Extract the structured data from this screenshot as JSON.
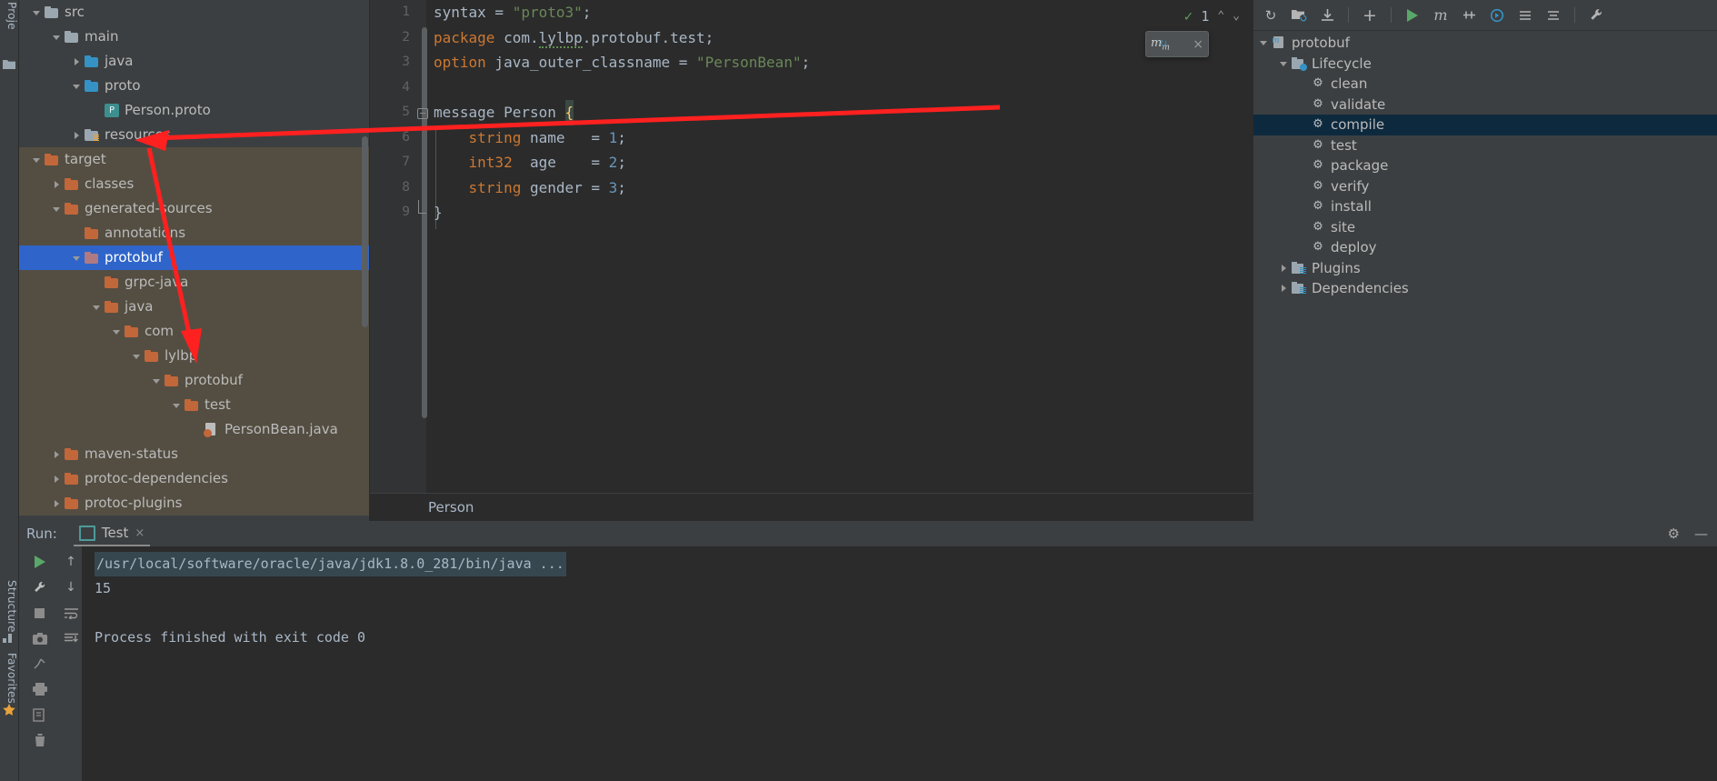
{
  "left_strip": {
    "project_tab": "Proje",
    "structure_tab": "Structure",
    "favorites_tab": "Favorites"
  },
  "project_tree": {
    "items": [
      {
        "label": "src",
        "depth": 1,
        "arrow": "down",
        "icon": "folder-grey",
        "scope": "src"
      },
      {
        "label": "main",
        "depth": 2,
        "arrow": "down",
        "icon": "folder-grey",
        "scope": "src"
      },
      {
        "label": "java",
        "depth": 3,
        "arrow": "right",
        "icon": "folder-blue",
        "scope": "src"
      },
      {
        "label": "proto",
        "depth": 3,
        "arrow": "down",
        "icon": "folder-blue",
        "scope": "src"
      },
      {
        "label": "Person.proto",
        "depth": 4,
        "arrow": "none",
        "icon": "proto-file",
        "scope": "src"
      },
      {
        "label": "resources",
        "depth": 3,
        "arrow": "right",
        "icon": "folder-resources",
        "scope": "src"
      },
      {
        "label": "target",
        "depth": 1,
        "arrow": "down",
        "icon": "folder-orange",
        "scope": "target"
      },
      {
        "label": "classes",
        "depth": 2,
        "arrow": "right",
        "icon": "folder-orange",
        "scope": "target"
      },
      {
        "label": "generated-sources",
        "depth": 2,
        "arrow": "down",
        "icon": "folder-orange",
        "scope": "target"
      },
      {
        "label": "annotations",
        "depth": 3,
        "arrow": "none",
        "icon": "folder-orange",
        "scope": "target"
      },
      {
        "label": "protobuf",
        "depth": 3,
        "arrow": "down",
        "icon": "folder-pink",
        "scope": "target",
        "selected": true
      },
      {
        "label": "grpc-java",
        "depth": 4,
        "arrow": "none",
        "icon": "folder-orange",
        "scope": "target"
      },
      {
        "label": "java",
        "depth": 4,
        "arrow": "down",
        "icon": "folder-orange",
        "scope": "target"
      },
      {
        "label": "com",
        "depth": 5,
        "arrow": "down",
        "icon": "folder-orange",
        "scope": "target"
      },
      {
        "label": "lylbp",
        "depth": 6,
        "arrow": "down",
        "icon": "folder-orange",
        "scope": "target"
      },
      {
        "label": "protobuf",
        "depth": 7,
        "arrow": "down",
        "icon": "folder-orange",
        "scope": "target"
      },
      {
        "label": "test",
        "depth": 8,
        "arrow": "down",
        "icon": "folder-orange",
        "scope": "target"
      },
      {
        "label": "PersonBean.java",
        "depth": 9,
        "arrow": "none",
        "icon": "java-file",
        "scope": "target"
      },
      {
        "label": "maven-status",
        "depth": 2,
        "arrow": "right",
        "icon": "folder-orange",
        "scope": "target"
      },
      {
        "label": "protoc-dependencies",
        "depth": 2,
        "arrow": "right",
        "icon": "folder-orange",
        "scope": "target"
      },
      {
        "label": "protoc-plugins",
        "depth": 2,
        "arrow": "right",
        "icon": "folder-orange",
        "scope": "target"
      }
    ]
  },
  "editor": {
    "breadcrumb": "Person",
    "inspection": {
      "count": "1",
      "up": "⌃",
      "down": "⌄"
    },
    "maven_popup": {
      "glyph": "m",
      "close": "×"
    },
    "lines": [
      {
        "n": "1",
        "tokens": [
          {
            "t": "syntax",
            "c": "pl"
          },
          {
            "t": " = ",
            "c": "pl"
          },
          {
            "t": "\"proto3\"",
            "c": "str"
          },
          {
            "t": ";",
            "c": "pl"
          }
        ]
      },
      {
        "n": "2",
        "tokens": [
          {
            "t": "package",
            "c": "kw"
          },
          {
            "t": " com.",
            "c": "pl"
          },
          {
            "t": "lylbp",
            "c": "squig"
          },
          {
            "t": ".protobuf.test;",
            "c": "pl"
          }
        ]
      },
      {
        "n": "3",
        "tokens": [
          {
            "t": "option",
            "c": "kw"
          },
          {
            "t": " java_outer_classname = ",
            "c": "pl"
          },
          {
            "t": "\"PersonBean\"",
            "c": "str"
          },
          {
            "t": ";",
            "c": "pl"
          }
        ]
      },
      {
        "n": "4",
        "tokens": []
      },
      {
        "n": "5",
        "fold": true,
        "tokens": [
          {
            "t": "message",
            "c": "pl"
          },
          {
            "t": " Person ",
            "c": "pl"
          },
          {
            "t": "{",
            "c": "caret"
          }
        ]
      },
      {
        "n": "6",
        "tokens": [
          {
            "t": "    ",
            "c": "pl"
          },
          {
            "t": "string",
            "c": "kw"
          },
          {
            "t": " name   = ",
            "c": "pl"
          },
          {
            "t": "1",
            "c": "num"
          },
          {
            "t": ";",
            "c": "pl"
          }
        ]
      },
      {
        "n": "7",
        "tokens": [
          {
            "t": "    ",
            "c": "pl"
          },
          {
            "t": "int32",
            "c": "kw"
          },
          {
            "t": "  age    = ",
            "c": "pl"
          },
          {
            "t": "2",
            "c": "num"
          },
          {
            "t": ";",
            "c": "pl"
          }
        ]
      },
      {
        "n": "8",
        "tokens": [
          {
            "t": "    ",
            "c": "pl"
          },
          {
            "t": "string",
            "c": "kw"
          },
          {
            "t": " gender = ",
            "c": "pl"
          },
          {
            "t": "3",
            "c": "num"
          },
          {
            "t": ";",
            "c": "pl"
          }
        ]
      },
      {
        "n": "9",
        "foldend": true,
        "tokens": [
          {
            "t": "}",
            "c": "pl"
          }
        ]
      }
    ]
  },
  "maven": {
    "toolbar_icons": [
      "reload-icon",
      "add-folder-icon",
      "download-sources-icon",
      "plus-icon",
      "run-icon",
      "maven-goal-icon",
      "skip-tests-icon",
      "execute-icon",
      "collapse-icon",
      "expand-icon",
      "settings-wrench-icon"
    ],
    "tree": [
      {
        "label": "protobuf",
        "depth": 0,
        "arrow": "down",
        "icon": "maven-module-icon"
      },
      {
        "label": "Lifecycle",
        "depth": 1,
        "arrow": "down",
        "icon": "lifecycle-folder-icon"
      },
      {
        "label": "clean",
        "depth": 2,
        "arrow": "none",
        "icon": "gear-icon"
      },
      {
        "label": "validate",
        "depth": 2,
        "arrow": "none",
        "icon": "gear-icon"
      },
      {
        "label": "compile",
        "depth": 2,
        "arrow": "none",
        "icon": "gear-icon",
        "selected": true
      },
      {
        "label": "test",
        "depth": 2,
        "arrow": "none",
        "icon": "gear-icon"
      },
      {
        "label": "package",
        "depth": 2,
        "arrow": "none",
        "icon": "gear-icon"
      },
      {
        "label": "verify",
        "depth": 2,
        "arrow": "none",
        "icon": "gear-icon"
      },
      {
        "label": "install",
        "depth": 2,
        "arrow": "none",
        "icon": "gear-icon"
      },
      {
        "label": "site",
        "depth": 2,
        "arrow": "none",
        "icon": "gear-icon"
      },
      {
        "label": "deploy",
        "depth": 2,
        "arrow": "none",
        "icon": "gear-icon"
      },
      {
        "label": "Plugins",
        "depth": 1,
        "arrow": "right",
        "icon": "plugins-folder-icon"
      },
      {
        "label": "Dependencies",
        "depth": 1,
        "arrow": "right",
        "icon": "dependencies-folder-icon"
      }
    ]
  },
  "run_panel": {
    "label": "Run:",
    "tab": "Test",
    "tab_close": "×",
    "settings_icon": "gear-icon",
    "minimize_icon": "minimize-icon",
    "tool_buttons": [
      "rerun-icon",
      "edit-configuration-icon",
      "stop-icon",
      "screenshot-icon",
      "dump-threads-icon",
      "print-icon",
      "export-icon",
      "trash-icon"
    ],
    "nav_buttons": [
      "scroll-up-icon",
      "scroll-down-icon",
      "soft-wrap-icon",
      "scroll-to-end-icon"
    ],
    "console": [
      "/usr/local/software/oracle/java/jdk1.8.0_281/bin/java ...",
      "15",
      "",
      "Process finished with exit code 0"
    ]
  },
  "colors": {
    "background": "#3c3f41",
    "editor_bg": "#2b2b2b",
    "selection_blue": "#2f65ca",
    "maven_selection": "#0d293e",
    "target_scope": "#544e42",
    "annotation_red": "#ff2020",
    "string_green": "#6a8759",
    "keyword_orange": "#cc7832",
    "number_blue": "#6897bb"
  }
}
